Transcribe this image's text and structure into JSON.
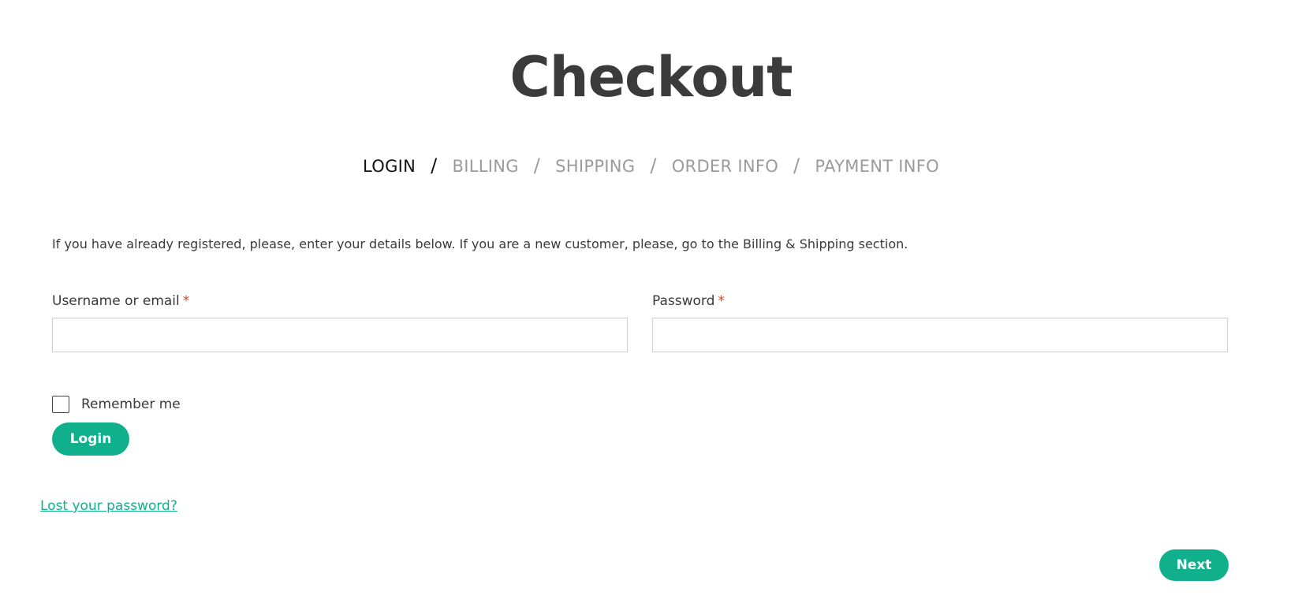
{
  "page": {
    "title": "Checkout"
  },
  "steps": [
    {
      "label": "LOGIN",
      "active": true
    },
    {
      "label": "BILLING",
      "active": false
    },
    {
      "label": "SHIPPING",
      "active": false
    },
    {
      "label": "ORDER INFO",
      "active": false
    },
    {
      "label": "PAYMENT INFO",
      "active": false
    }
  ],
  "separator": "/",
  "intro_text": "If you have already registered, please, enter your details below. If you are a new customer, please, go to the Billing & Shipping section.",
  "form": {
    "username": {
      "label": "Username or email",
      "required_mark": "*",
      "value": ""
    },
    "password": {
      "label": "Password",
      "required_mark": "*",
      "value": ""
    },
    "remember": {
      "label": "Remember me",
      "checked": false
    },
    "login_button": "Login",
    "lost_password_link": "Lost your password?"
  },
  "next_button": "Next",
  "colors": {
    "accent": "#10b08c",
    "required": "#e2401c",
    "step_inactive": "#9b9b9b",
    "step_active": "#111111"
  }
}
